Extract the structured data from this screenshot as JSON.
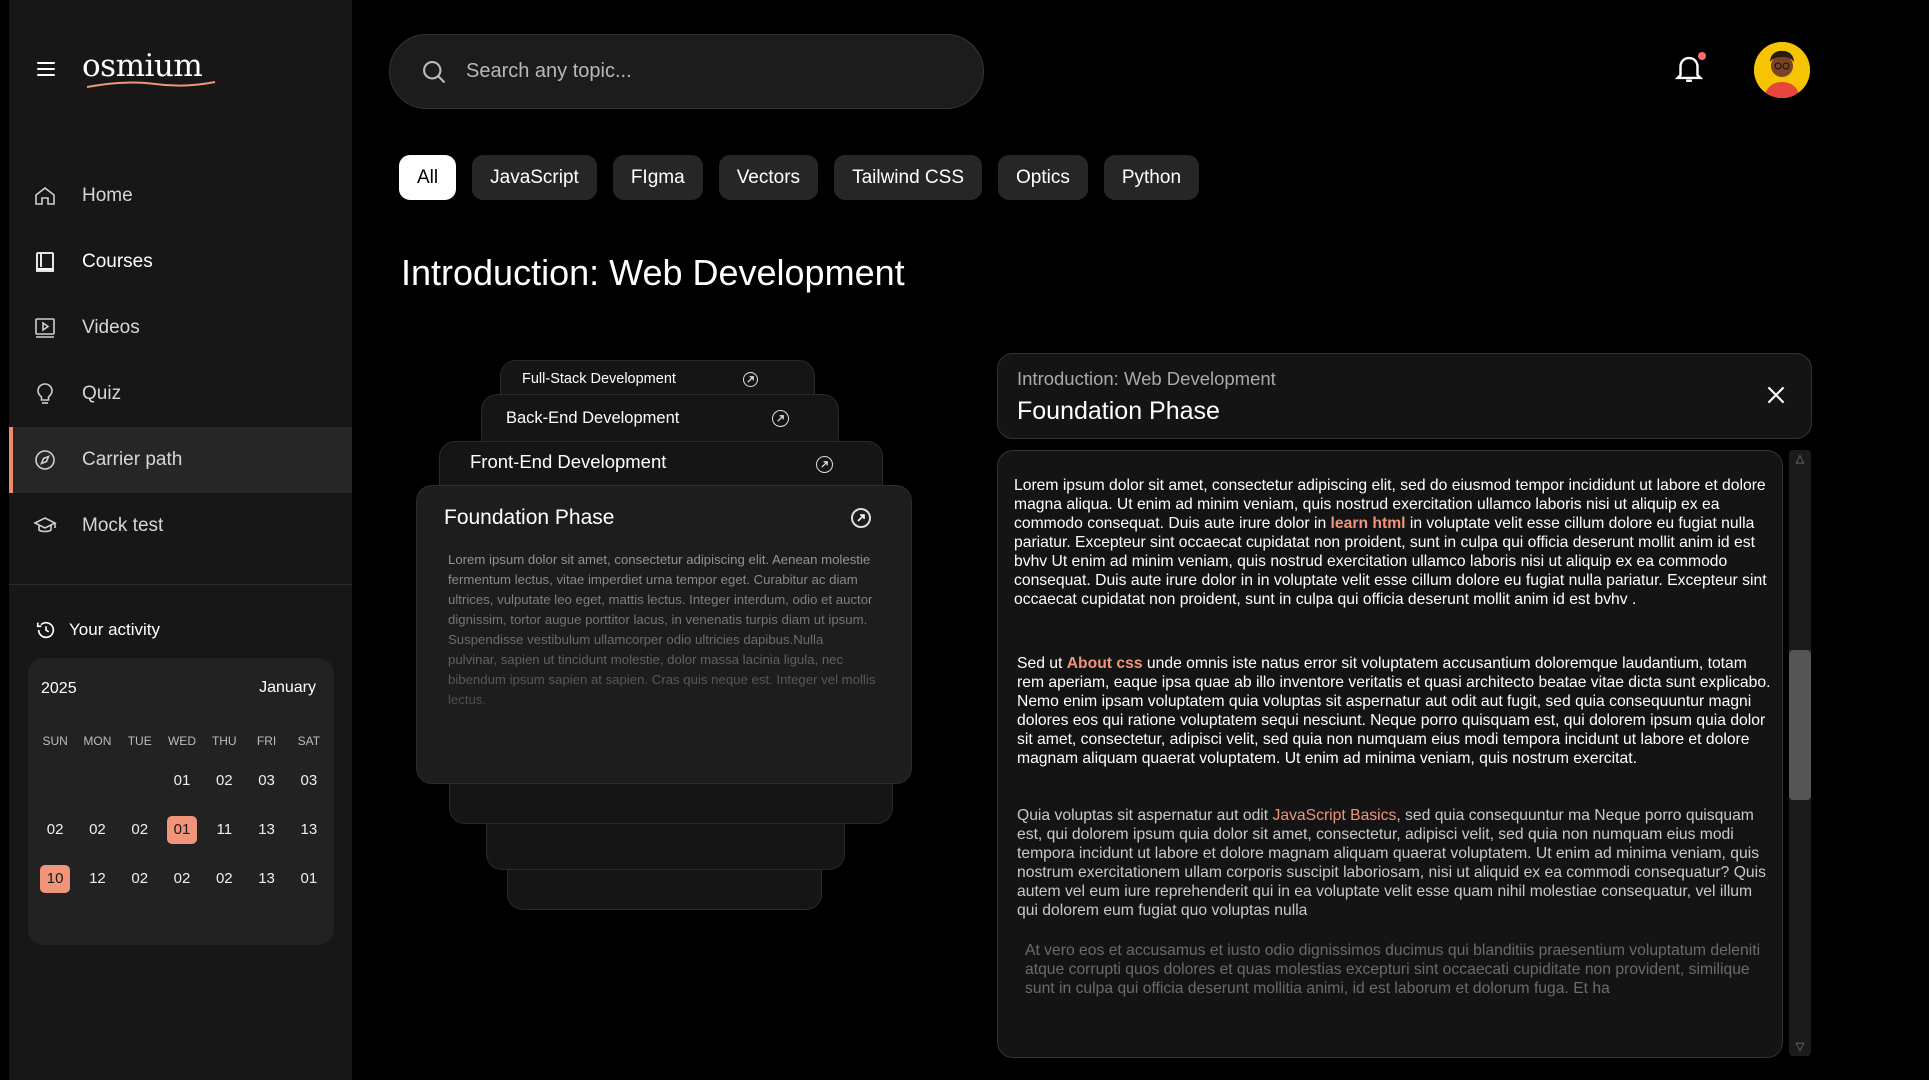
{
  "app": {
    "logo": "osmium"
  },
  "sidebar": {
    "items": [
      {
        "label": "Home",
        "icon": "home-icon"
      },
      {
        "label": "Courses",
        "icon": "book-icon"
      },
      {
        "label": "Videos",
        "icon": "video-icon"
      },
      {
        "label": "Quiz",
        "icon": "lightbulb-icon"
      },
      {
        "label": "Carrier path",
        "icon": "compass-icon"
      },
      {
        "label": "Mock test",
        "icon": "graduation-cap-icon"
      }
    ],
    "activity_title": "Your activity"
  },
  "calendar": {
    "year": "2025",
    "month": "January",
    "weekdays": [
      "SUN",
      "MON",
      "TUE",
      "WED",
      "THU",
      "FRI",
      "SAT"
    ],
    "rows": [
      [
        "",
        "",
        "",
        "01",
        "02",
        "03",
        "03"
      ],
      [
        "02",
        "02",
        "02",
        "01",
        "11",
        "13",
        "13"
      ],
      [
        "10",
        "12",
        "02",
        "02",
        "02",
        "13",
        "01"
      ]
    ],
    "highlight_color": "#f0947a"
  },
  "search": {
    "placeholder": "Search any topic..."
  },
  "chips": [
    "All",
    "JavaScript",
    "FIgma",
    "Vectors",
    "Tailwind CSS",
    "Optics",
    "Python"
  ],
  "page_title": "Introduction: Web Development",
  "stack": {
    "fullstack": "Full-Stack Development",
    "backend": "Back-End Development",
    "frontend": "Front-End Development",
    "foundation": "Foundation Phase",
    "foundation_text": "Lorem ipsum dolor sit amet, consectetur adipiscing elit. Aenean molestie fermentum lectus, vitae imperdiet urna tempor eget. Curabitur ac diam ultrices, vulputate leo eget, mattis lectus. Integer interdum, odio et auctor dignissim, tortor augue porttitor lacus, in venenatis turpis diam ut ipsum. Suspendisse vestibulum ullamcorper odio ultricies dapibus.Nulla pulvinar, sapien ut tincidunt molestie, dolor massa lacinia ligula, nec bibendum ipsum sapien at sapien. Cras quis neque est. Integer vel mollis lectus."
  },
  "panel": {
    "subtitle": "Introduction: Web Development",
    "title": "Foundation Phase",
    "p1_a": "Lorem ipsum dolor sit amet, consectetur adipiscing elit, sed do eiusmod tempor incididunt ut labore et dolore magna aliqua. Ut enim ad minim veniam, quis nostrud exercitation ullamco laboris nisi ut aliquip ex ea commodo consequat. Duis aute irure dolor in ",
    "p1_link": "learn html",
    "p1_b": " in voluptate velit esse cillum dolore eu fugiat nulla pariatur. Excepteur sint occaecat cupidatat non proident, sunt in culpa qui officia deserunt mollit anim id est  bvhv  Ut enim ad minim veniam, quis nostrud exercitation ullamco laboris nisi ut aliquip ex ea commodo consequat. Duis aute irure dolor in  in voluptate velit esse cillum dolore eu fugiat nulla pariatur. Excepteur sint occaecat cupidatat non proident, sunt in culpa qui officia deserunt mollit anim id est  bvhv .",
    "p2_a": "Sed ut ",
    "p2_link": "About css",
    "p2_b": " unde omnis iste natus error sit voluptatem accusantium doloremque laudantium, totam rem aperiam, eaque ipsa quae ab illo inventore veritatis et quasi architecto beatae vitae dicta sunt explicabo. Nemo enim ipsam voluptatem quia voluptas sit aspernatur aut odit aut fugit, sed quia consequuntur magni dolores eos qui ratione voluptatem sequi nesciunt. Neque porro quisquam est, qui dolorem ipsum quia dolor sit amet, consectetur, adipisci velit, sed quia non numquam eius modi tempora incidunt ut labore et dolore magnam aliquam quaerat voluptatem. Ut enim ad minima veniam, quis nostrum exercitat.",
    "p3_a": "Quia voluptas sit aspernatur aut odit ",
    "p3_link": "JavaScript Basics",
    "p3_b": ", sed quia consequuntur ma Neque porro quisquam est, qui dolorem ipsum quia dolor sit amet, consectetur, adipisci velit, sed quia non numquam eius modi tempora incidunt ut labore et dolore magnam aliquam quaerat voluptatem. Ut enim ad minima veniam, quis nostrum exercitationem ullam corporis suscipit laboriosam, nisi ut aliquid ex ea commodi consequatur? Quis autem vel eum iure reprehenderit qui in ea voluptate velit esse quam nihil molestiae consequatur, vel illum qui dolorem eum fugiat quo voluptas nulla",
    "p4": "At vero eos et accusamus et iusto odio dignissimos ducimus qui blanditiis praesentium voluptatum deleniti atque corrupti quos dolores et quas molestias excepturi sint occaecati cupiditate non provident, similique sunt in culpa qui officia deserunt mollitia animi, id est laborum et dolorum fuga. Et ha"
  }
}
